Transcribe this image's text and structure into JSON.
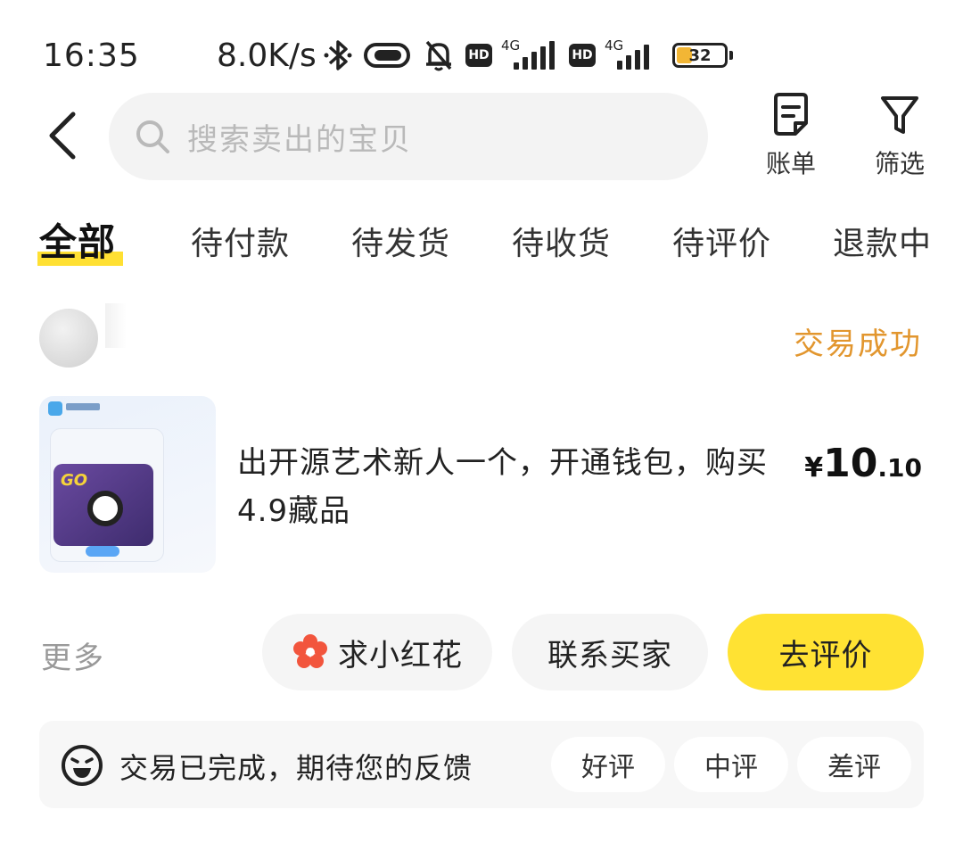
{
  "status_bar": {
    "time": "16:35",
    "speed": "8.0K/s",
    "sim1_label": "4G",
    "sim2_label": "4G",
    "hd_label": "HD",
    "battery": "32",
    "battery_level": 0.32,
    "icons": [
      "bluetooth-icon",
      "link-icon",
      "mute-icon",
      "hd-icon",
      "signal-icon",
      "battery-icon"
    ]
  },
  "header": {
    "search_placeholder": "搜索卖出的宝贝",
    "bill_label": "账单",
    "filter_label": "筛选"
  },
  "tabs": [
    {
      "label": "全部",
      "active": true
    },
    {
      "label": "待付款"
    },
    {
      "label": "待发货"
    },
    {
      "label": "待收货"
    },
    {
      "label": "待评价"
    },
    {
      "label": "退款中"
    }
  ],
  "order": {
    "status": "交易成功",
    "title": "出开源艺术新人一个，开通钱包，购买4.9藏品",
    "price_currency": "¥",
    "price_integer": "10",
    "price_decimal": ".10",
    "more_label": "更多",
    "actions": {
      "flower": "求小红花",
      "contact": "联系买家",
      "review": "去评价"
    },
    "feedback": {
      "message": "交易已完成，期待您的反馈",
      "options": [
        "好评",
        "中评",
        "差评"
      ]
    }
  },
  "colors": {
    "accent_yellow": "#ffe233",
    "status_orange": "#e2962e",
    "flower_red": "#f2553d"
  }
}
